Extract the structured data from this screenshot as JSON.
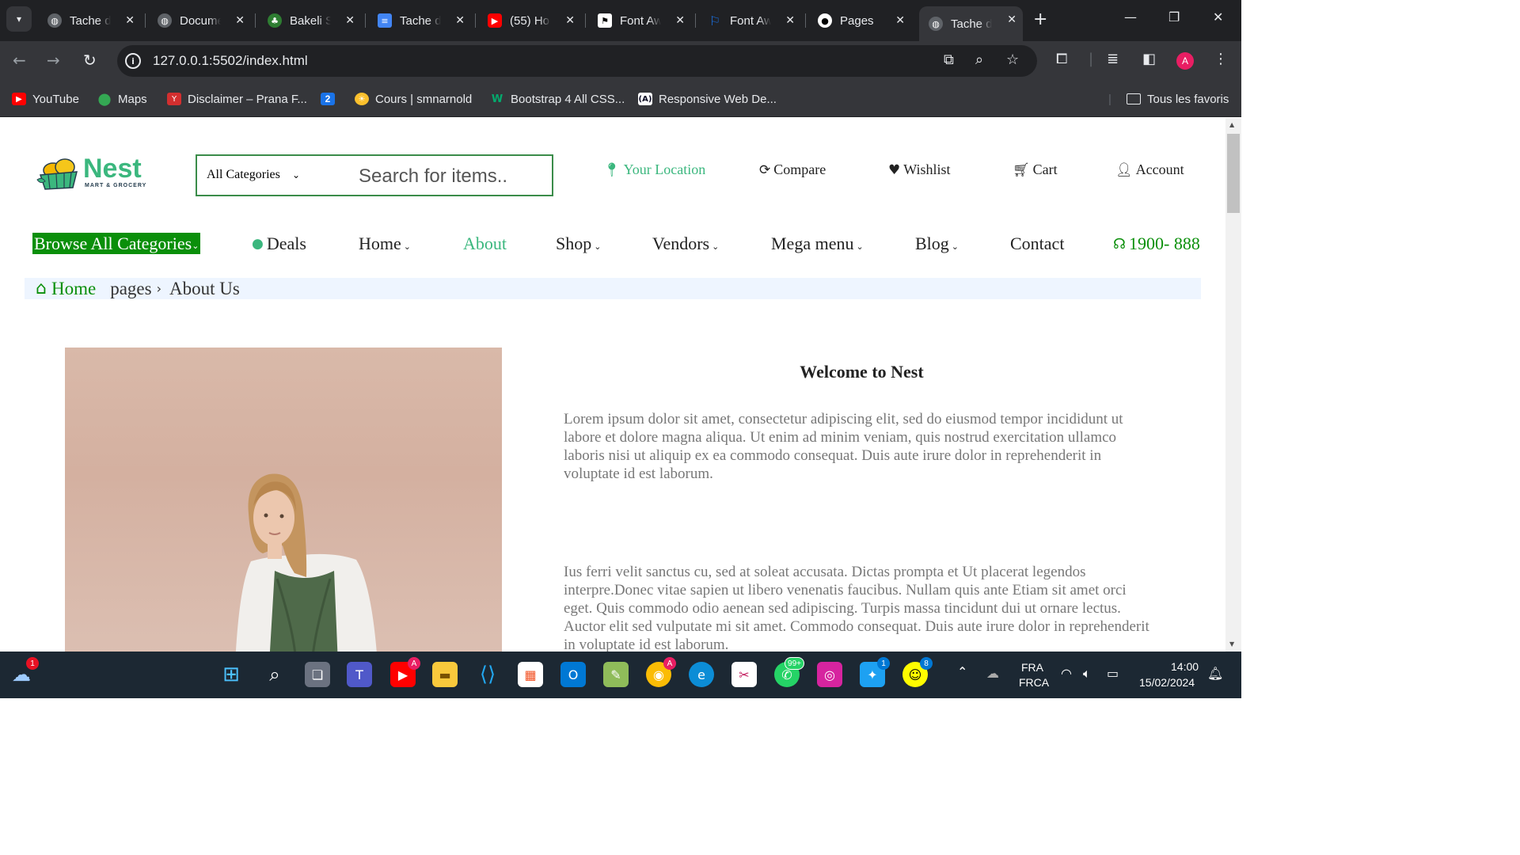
{
  "browser": {
    "tabs": [
      {
        "title": "Tache de",
        "icon": "globe-icon",
        "color": "#5f6368"
      },
      {
        "title": "Document",
        "icon": "globe-icon",
        "color": "#5f6368"
      },
      {
        "title": "Bakeli SI",
        "icon": "bakeli-icon",
        "color": "#2e7d32"
      },
      {
        "title": "Tache de",
        "icon": "docs-icon",
        "color": "#4285f4"
      },
      {
        "title": "(55) Ho",
        "icon": "youtube-icon",
        "color": "#ff0000"
      },
      {
        "title": "Font Aw",
        "icon": "flag-icon",
        "color": "#000000"
      },
      {
        "title": "Font Aw",
        "icon": "flag-outline-icon",
        "color": "#1a73e8"
      },
      {
        "title": "Pages",
        "icon": "github-icon",
        "color": "#000000"
      },
      {
        "title": "Tache de",
        "icon": "globe-icon",
        "color": "#5f6368"
      }
    ],
    "url": "127.0.0.1:5502/index.html",
    "bookmarks": [
      {
        "label": "YouTube",
        "icon": "youtube-icon",
        "color": "#ff0000"
      },
      {
        "label": "Maps",
        "icon": "maps-pin-icon",
        "color": "#34a853"
      },
      {
        "label": "Disclaimer – Prana F...",
        "icon": "disclaimer-icon",
        "color": "#d32f2f"
      },
      {
        "label": "2",
        "icon": "calendar-icon",
        "color": "#1a73e8"
      },
      {
        "label": "Cours | smnarnold",
        "icon": "sun-icon",
        "color": "#fbc02d"
      },
      {
        "label": "Bootstrap 4 All CSS...",
        "icon": "w3-icon",
        "color": "#04aa6d"
      },
      {
        "label": "Responsive Web De...",
        "icon": "freecodecamp-icon",
        "color": "#0a0a23"
      }
    ],
    "all_bookmarks": "Tous les favoris",
    "profile_initial": "A"
  },
  "site": {
    "logo": {
      "name": "Nest",
      "tagline": "MART & GROCERY"
    },
    "search": {
      "category": "All Categories",
      "placeholder": "Search for items.."
    },
    "header_links": {
      "location": "Your Location",
      "compare": "Compare",
      "wishlist": "Wishlist",
      "cart": "Cart",
      "account": "Account"
    },
    "nav": {
      "browse": "Browse All Categories",
      "deals": "Deals",
      "home": "Home",
      "about": "About",
      "shop": "Shop",
      "vendors": "Vendors",
      "mega": "Mega menu",
      "blog": "Blog",
      "contact": "Contact",
      "phone": "1900- 888"
    },
    "breadcrumb": {
      "home": "Home",
      "pages": "pages",
      "current": "About Us"
    },
    "about": {
      "title": "Welcome to Nest",
      "p1": "Lorem ipsum dolor sit amet, consectetur adipiscing elit, sed do eiusmod tempor incididunt ut labore et dolore magna aliqua. Ut enim ad minim veniam, quis nostrud exercitation ullamco laboris nisi ut aliquip ex ea commodo consequat. Duis aute irure dolor in reprehenderit in voluptate id est laborum.",
      "p2": "Ius ferri velit sanctus cu, sed at soleat accusata. Dictas prompta et Ut placerat legendos interpre.Donec vitae sapien ut libero venenatis faucibus. Nullam quis ante Etiam sit amet orci eget. Quis commodo odio aenean sed adipiscing. Turpis massa tincidunt dui ut ornare lectus. Auctor elit sed vulputate mi sit amet. Commodo consequat. Duis aute irure dolor in reprehenderit in voluptate id est laborum."
    },
    "colors": {
      "brand": "#3bb77e",
      "accent_green": "#0a8f0a"
    }
  },
  "taskbar": {
    "weather_badge": "1",
    "chrome_badge": "A",
    "whatsapp_badge": "99+",
    "twitter_badge": "1",
    "snapchat_badge": "8",
    "lang1": "FRA",
    "lang2": "FRCA",
    "time": "14:00",
    "date": "15/02/2024"
  }
}
